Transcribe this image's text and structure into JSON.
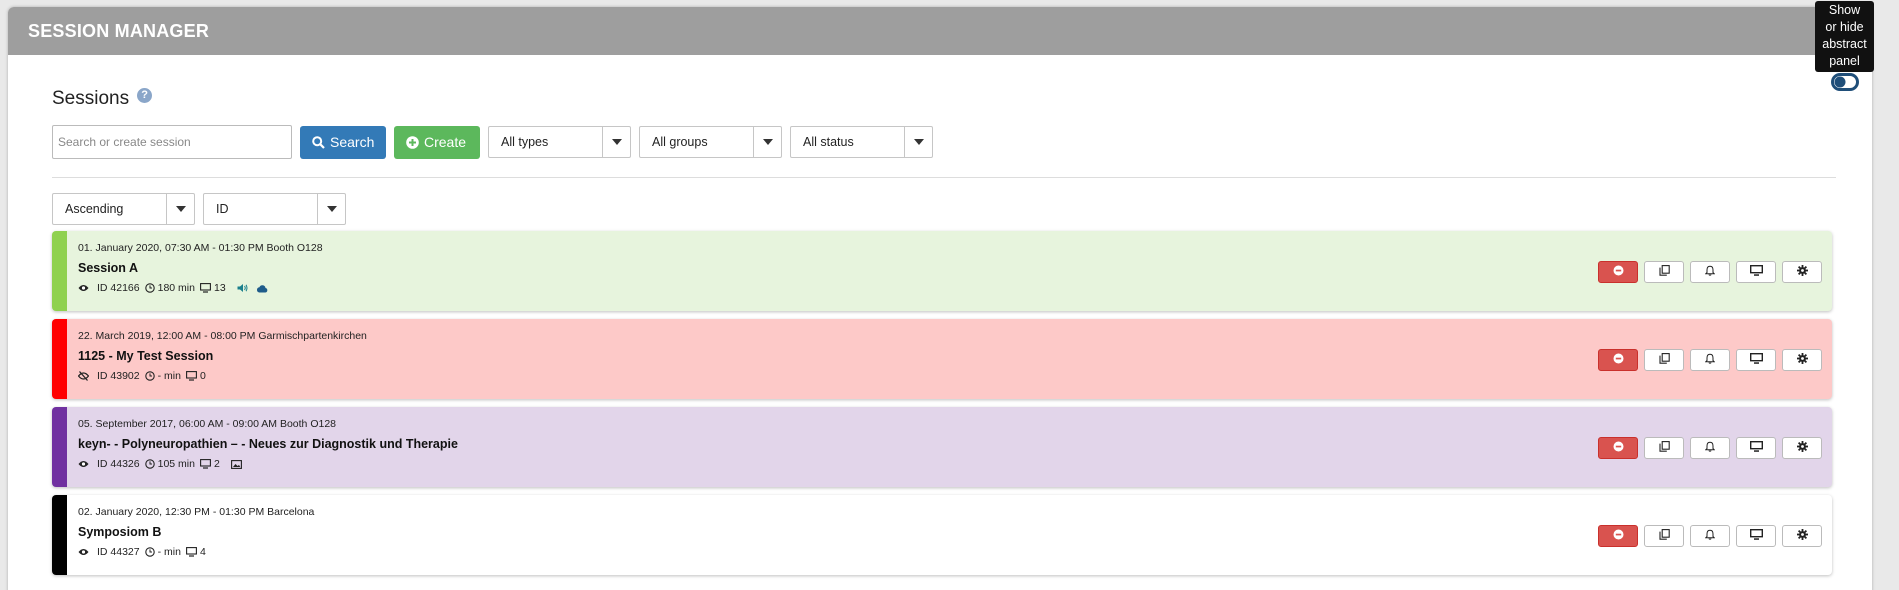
{
  "header": {
    "title": "SESSION MANAGER"
  },
  "page": {
    "title": "Sessions",
    "help_icon": "?"
  },
  "toolbar": {
    "search_placeholder": "Search or create session",
    "search_label": "Search",
    "create_label": "Create",
    "filters": [
      "All types",
      "All groups",
      "All status"
    ]
  },
  "sort": {
    "order": "Ascending",
    "field": "ID"
  },
  "tooltip": {
    "text_lines": [
      "Show",
      "or hide",
      "abstract",
      "panel"
    ]
  },
  "colors": {
    "green": "#8fd14f",
    "red": "#f00000",
    "purple": "#7030a0",
    "black": "#000000"
  },
  "sessions": [
    {
      "when": "01. January 2020, 07:30 AM - 01:30 PM Booth O128",
      "name": "Session A",
      "id": "ID 42166",
      "duration": "180 min",
      "screens": "13",
      "visible": true,
      "extras": [
        "audio",
        "cloud"
      ],
      "bar_color": "#8fd14f",
      "bg": "#e7f4dd"
    },
    {
      "when": "22. March 2019, 12:00 AM - 08:00 PM Garmischpartenkirchen",
      "name": "1125 - My Test Session",
      "id": "ID 43902",
      "duration": "- min",
      "screens": "0",
      "visible": false,
      "extras": [],
      "bar_color": "#ff0000",
      "bg": "#fdc9c8"
    },
    {
      "when": "05. September 2017, 06:00 AM - 09:00 AM Booth O128",
      "name": "keyn- - Polyneuropathien – - Neues zur Diagnostik und Therapie",
      "id": "ID 44326",
      "duration": "105 min",
      "screens": "2",
      "visible": true,
      "extras": [
        "image"
      ],
      "bar_color": "#7030a0",
      "bg": "#e2d5ea"
    },
    {
      "when": "02. January 2020, 12:30 PM - 01:30 PM Barcelona",
      "name": "Symposiom B",
      "id": "ID 44327",
      "duration": "- min",
      "screens": "4",
      "visible": true,
      "extras": [],
      "bar_color": "#000000",
      "bg": "#ffffff"
    }
  ]
}
